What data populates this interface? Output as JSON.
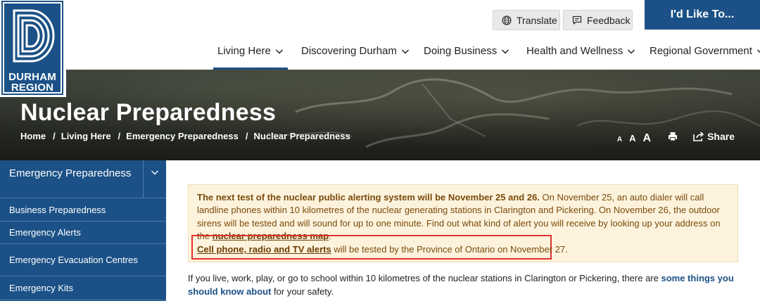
{
  "brand": {
    "logo_line1": "DURHAM",
    "logo_line2": "REGION",
    "primary_color": "#1b5186"
  },
  "utility": {
    "translate_label": "Translate",
    "feedback_label": "Feedback",
    "like_to_label": "I'd Like To..."
  },
  "nav": {
    "items": [
      {
        "label": "Living Here",
        "active": true
      },
      {
        "label": "Discovering Durham"
      },
      {
        "label": "Doing Business"
      },
      {
        "label": "Health and Wellness"
      },
      {
        "label": "Regional Government"
      }
    ]
  },
  "banner": {
    "title": "Nuclear Preparedness",
    "breadcrumb": [
      "Home",
      "Living Here",
      "Emergency Preparedness",
      "Nuclear Preparedness"
    ],
    "breadcrumb_sep": "/",
    "font_small": "A",
    "font_medium": "A",
    "font_large": "A",
    "share_label": "Share"
  },
  "sidebar": {
    "heading": "Emergency Preparedness",
    "items": [
      {
        "label": "Business Preparedness"
      },
      {
        "label": "Emergency Alerts"
      },
      {
        "label": "Emergency Evacuation Centres"
      },
      {
        "label": "Emergency Kits"
      }
    ]
  },
  "alert": {
    "bold_intro": "The next test of the nuclear public alerting system will be November 25 and 26.",
    "body": " On November 25, an auto dialer will call landline phones within 10 kilometres of the nuclear generating stations in Clarington and Pickering. On November 26, the outdoor sirens will be tested and will sound for up to one minute. Find out what kind of alert you will receive by looking up your address on the ",
    "map_link": "nuclear preparedness map",
    "period": ".",
    "p2_link": "Cell phone, radio and TV alerts",
    "p2_text": " will be tested by the Province of Ontario on November 27."
  },
  "main": {
    "intro_text": "If you live, work, play, or go to school within 10 kilometres of the nuclear stations in Clarington or Pickering, there are ",
    "intro_link": "some things you should know about",
    "intro_end": " for your safety."
  }
}
